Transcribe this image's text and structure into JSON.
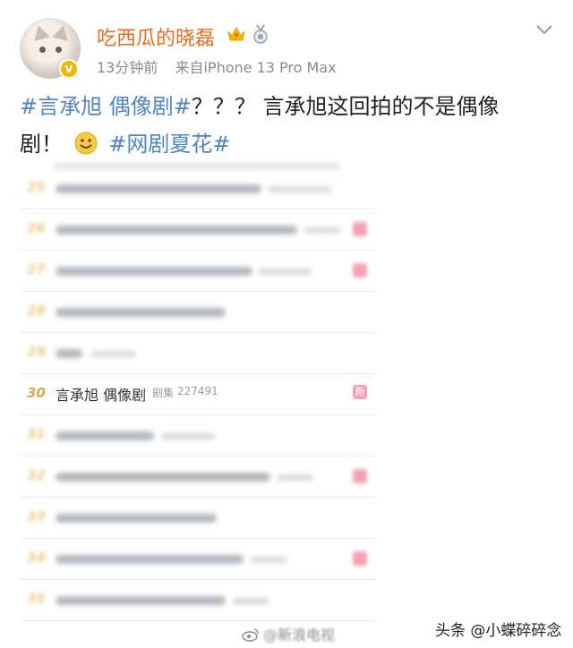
{
  "header": {
    "username": "吃西瓜的晓磊",
    "time": "13分钟前",
    "source": "来自iPhone 13 Pro Max",
    "icons": [
      "crown-icon",
      "medal-icon",
      "chevron-down-icon"
    ]
  },
  "post": {
    "hashtag1": "#言承旭 偶像剧#",
    "text1": "？？？ 言承旭这回拍的不是偶像",
    "text2": "剧！",
    "emoji": "smile-emoji",
    "hashtag2": "#网剧夏花#"
  },
  "hot_list": {
    "blurred_ranks": [
      "25",
      "26",
      "27",
      "28",
      "29",
      "31",
      "32",
      "33",
      "34",
      "35"
    ],
    "visible_item": {
      "rank": "30",
      "title": "言承旭 偶像剧",
      "category": "剧集",
      "heat": "227491",
      "badge": "新"
    }
  },
  "watermark": {
    "text": "@新浪电视"
  },
  "footer": {
    "account": "头条 @小蝶碎碎念"
  },
  "colors": {
    "username": "#e86b1c",
    "hashtag": "#4f84c4",
    "rank": "#e6a23c",
    "new_badge": "#f7a3b3"
  }
}
